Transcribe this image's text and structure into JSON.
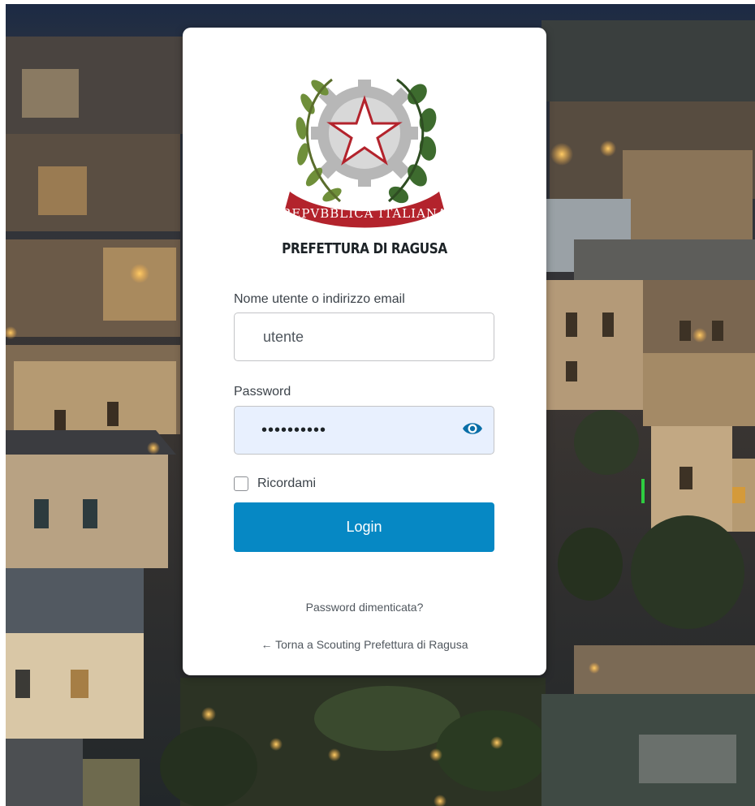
{
  "organization": {
    "name": "PREFETTURA DI RAGUSA",
    "emblem_text": "REPVBBLICA ITALIANA"
  },
  "login_form": {
    "username_label": "Nome utente o indirizzo email",
    "username_value": "utente",
    "password_label": "Password",
    "password_value": "••••••••••",
    "password_toggle_icon": "eye-icon",
    "remember_label": "Ricordami",
    "remember_checked": false,
    "submit_label": "Login"
  },
  "links": {
    "lost_password": "Password dimenticata?",
    "back_to_site": "← Torna a Scouting Prefettura di Ragusa"
  },
  "colors": {
    "primary_button": "#0688c4",
    "eye_icon": "#0a6fa8",
    "password_field_bg": "#e8f0fe",
    "emblem_red": "#b3232c",
    "emblem_green": "#3d6b2e",
    "emblem_gray": "#b7b7b7"
  }
}
